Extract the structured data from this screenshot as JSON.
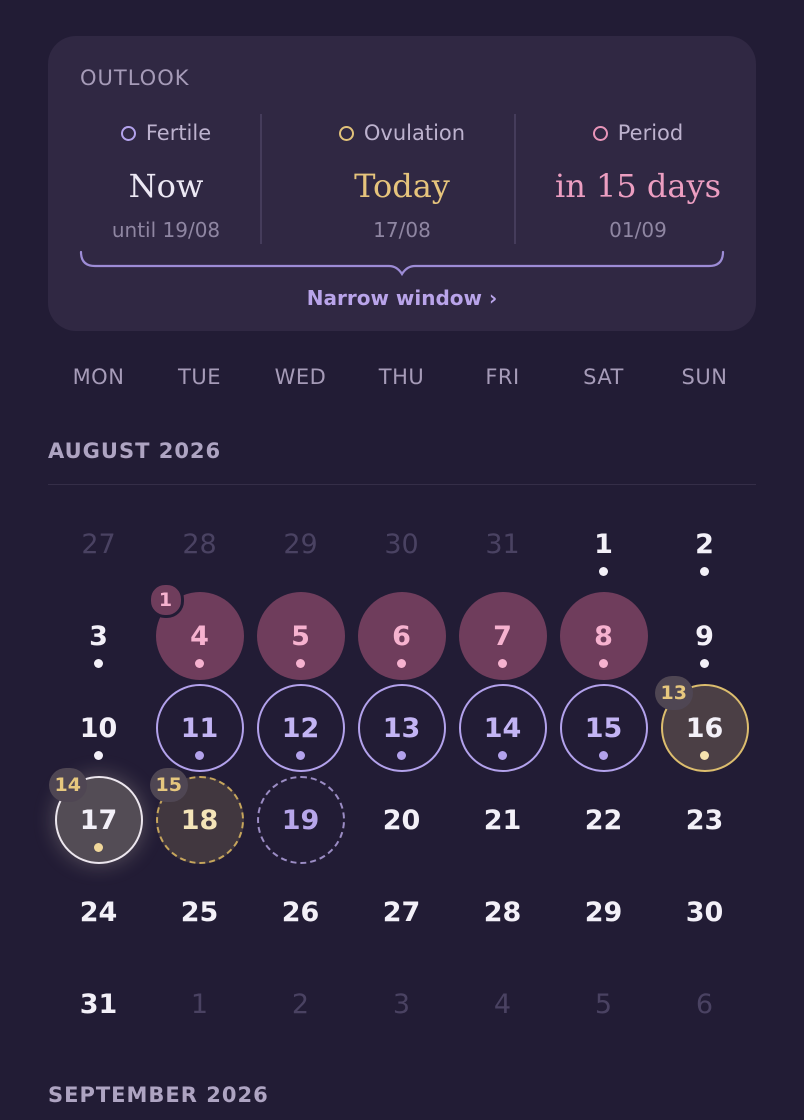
{
  "outlook": {
    "title": "OUTLOOK",
    "fertile": {
      "label": "Fertile",
      "value": "Now",
      "sub": "until 19/08",
      "color": "#b3a2ec"
    },
    "ovulation": {
      "label": "Ovulation",
      "value": "Today",
      "sub": "17/08",
      "color": "#e2c27a"
    },
    "period": {
      "label": "Period",
      "value": "in 15 days",
      "sub": "01/09",
      "color": "#e895b9"
    },
    "link": "Narrow window ›"
  },
  "weekdays": [
    "MON",
    "TUE",
    "WED",
    "THU",
    "FRI",
    "SAT",
    "SUN"
  ],
  "months": {
    "august": "AUGUST 2026",
    "september": "SEPTEMBER 2026"
  },
  "calendar": [
    {
      "n": "27",
      "s": "muted"
    },
    {
      "n": "28",
      "s": "muted"
    },
    {
      "n": "29",
      "s": "muted"
    },
    {
      "n": "30",
      "s": "muted"
    },
    {
      "n": "31",
      "s": "muted"
    },
    {
      "n": "1",
      "dot": true
    },
    {
      "n": "2",
      "dot": true
    },
    {
      "n": "3",
      "dot": true
    },
    {
      "n": "4",
      "s": "period",
      "dot": true,
      "badge": "1",
      "badge_style": "pink"
    },
    {
      "n": "5",
      "s": "period",
      "dot": true
    },
    {
      "n": "6",
      "s": "period",
      "dot": true
    },
    {
      "n": "7",
      "s": "period",
      "dot": true
    },
    {
      "n": "8",
      "s": "period",
      "dot": true
    },
    {
      "n": "9",
      "dot": true
    },
    {
      "n": "10",
      "dot": true
    },
    {
      "n": "11",
      "s": "fertile",
      "dot": true
    },
    {
      "n": "12",
      "s": "fertile",
      "dot": true
    },
    {
      "n": "13",
      "s": "fertile",
      "dot": true
    },
    {
      "n": "14",
      "s": "fertile",
      "dot": true
    },
    {
      "n": "15",
      "s": "fertile",
      "dot": true
    },
    {
      "n": "16",
      "s": "ov16",
      "dot": true,
      "badge": "13"
    },
    {
      "n": "17",
      "s": "today",
      "dot": true,
      "badge": "14"
    },
    {
      "n": "18",
      "s": "dash18",
      "badge": "15"
    },
    {
      "n": "19",
      "s": "dash19"
    },
    {
      "n": "20"
    },
    {
      "n": "21"
    },
    {
      "n": "22"
    },
    {
      "n": "23"
    },
    {
      "n": "24"
    },
    {
      "n": "25"
    },
    {
      "n": "26"
    },
    {
      "n": "27"
    },
    {
      "n": "28"
    },
    {
      "n": "29"
    },
    {
      "n": "30"
    },
    {
      "n": "31"
    },
    {
      "n": "1",
      "s": "muted"
    },
    {
      "n": "2",
      "s": "muted"
    },
    {
      "n": "3",
      "s": "muted"
    },
    {
      "n": "4",
      "s": "muted"
    },
    {
      "n": "5",
      "s": "muted"
    },
    {
      "n": "6",
      "s": "muted"
    }
  ]
}
